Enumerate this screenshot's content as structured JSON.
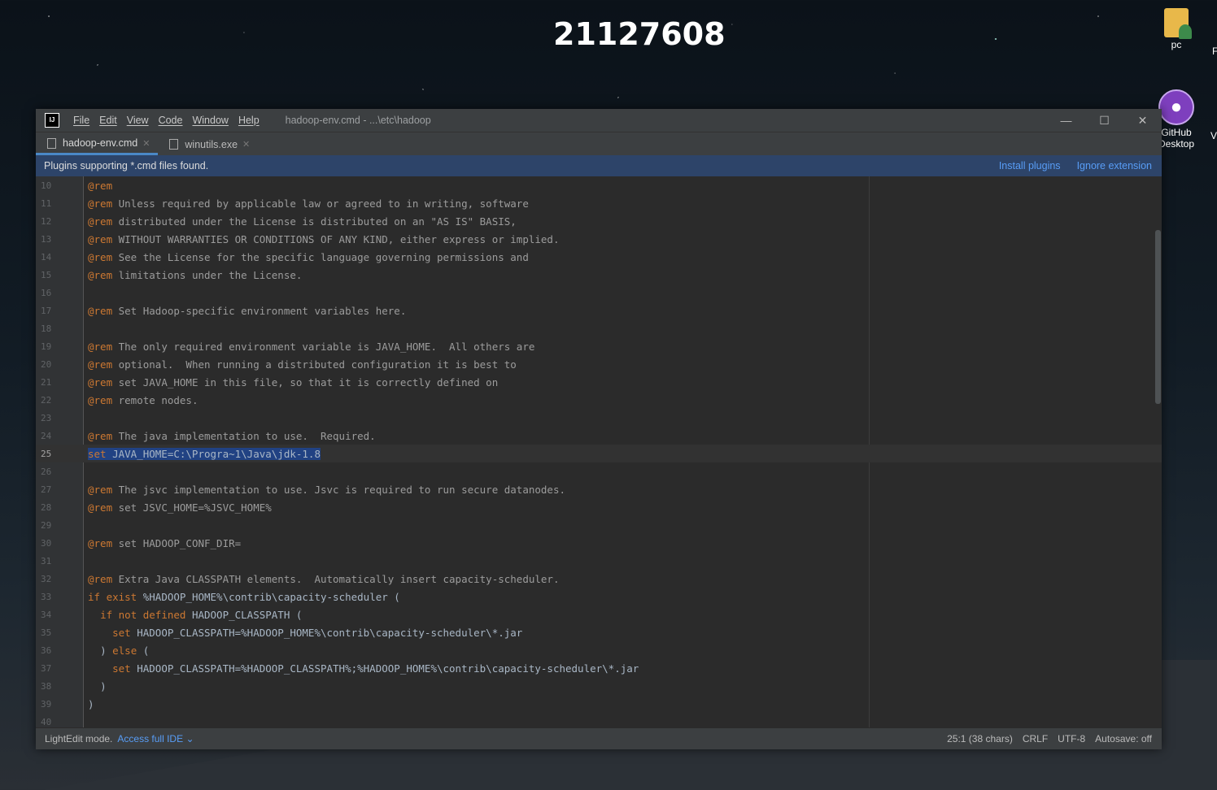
{
  "desktop": {
    "session_number": "21127608",
    "icons": [
      {
        "label": "pc",
        "icon": "user-folder-icon"
      },
      {
        "label": "GitHub Desktop",
        "icon": "github-desktop-icon"
      }
    ],
    "edge_letters": [
      "F",
      "V"
    ]
  },
  "window": {
    "logo": "IJ",
    "menu": [
      "File",
      "Edit",
      "View",
      "Code",
      "Window",
      "Help"
    ],
    "title": "hadoop-env.cmd - ...\\etc\\hadoop",
    "controls": {
      "minimize": "—",
      "maximize": "☐",
      "close": "✕"
    }
  },
  "tabs": [
    {
      "label": "hadoop-env.cmd",
      "active": true
    },
    {
      "label": "winutils.exe",
      "active": false
    }
  ],
  "banner": {
    "message": "Plugins supporting *.cmd files found.",
    "install": "Install plugins",
    "ignore": "Ignore extension"
  },
  "editor": {
    "current_line": 25,
    "lines": [
      {
        "n": "10",
        "kw": "@rem",
        "text": ""
      },
      {
        "n": "11",
        "kw": "@rem",
        "text": " Unless required by applicable law or agreed to in writing, software"
      },
      {
        "n": "12",
        "kw": "@rem",
        "text": " distributed under the License is distributed on an \"AS IS\" BASIS,"
      },
      {
        "n": "13",
        "kw": "@rem",
        "text": " WITHOUT WARRANTIES OR CONDITIONS OF ANY KIND, either express or implied."
      },
      {
        "n": "14",
        "kw": "@rem",
        "text": " See the License for the specific language governing permissions and"
      },
      {
        "n": "15",
        "kw": "@rem",
        "text": " limitations under the License."
      },
      {
        "n": "16",
        "kw": "",
        "text": ""
      },
      {
        "n": "17",
        "kw": "@rem",
        "text": " Set Hadoop-specific environment variables here."
      },
      {
        "n": "18",
        "kw": "",
        "text": ""
      },
      {
        "n": "19",
        "kw": "@rem",
        "text": " The only required environment variable is JAVA_HOME.  All others are"
      },
      {
        "n": "20",
        "kw": "@rem",
        "text": " optional.  When running a distributed configuration it is best to"
      },
      {
        "n": "21",
        "kw": "@rem",
        "text": " set JAVA_HOME in this file, so that it is correctly defined on"
      },
      {
        "n": "22",
        "kw": "@rem",
        "text": " remote nodes."
      },
      {
        "n": "23",
        "kw": "",
        "text": ""
      },
      {
        "n": "24",
        "kw": "@rem",
        "text": " The java implementation to use.  Required."
      },
      {
        "n": "25",
        "kw": "set",
        "text": " JAVA_HOME=C:\\Progra~1\\Java\\jdk-1.8",
        "selected": true
      },
      {
        "n": "26",
        "kw": "",
        "text": ""
      },
      {
        "n": "27",
        "kw": "@rem",
        "text": " The jsvc implementation to use. Jsvc is required to run secure datanodes."
      },
      {
        "n": "28",
        "kw": "@rem",
        "text": " set JSVC_HOME=%JSVC_HOME%"
      },
      {
        "n": "29",
        "kw": "",
        "text": ""
      },
      {
        "n": "30",
        "kw": "@rem",
        "text": " set HADOOP_CONF_DIR="
      },
      {
        "n": "31",
        "kw": "",
        "text": ""
      },
      {
        "n": "32",
        "kw": "@rem",
        "text": " Extra Java CLASSPATH elements.  Automatically insert capacity-scheduler."
      },
      {
        "n": "33",
        "kw": "if exist",
        "text": " %HADOOP_HOME%\\contrib\\capacity-scheduler ("
      },
      {
        "n": "34",
        "indent": "  ",
        "kw": "if not defined",
        "text": " HADOOP_CLASSPATH ("
      },
      {
        "n": "35",
        "indent": "    ",
        "kw": "set",
        "text": " HADOOP_CLASSPATH=%HADOOP_HOME%\\contrib\\capacity-scheduler\\*.jar"
      },
      {
        "n": "36",
        "indent": "  ",
        "kw": "",
        "text": ") ",
        "kw2": "else",
        "text2": " ("
      },
      {
        "n": "37",
        "indent": "    ",
        "kw": "set",
        "text": " HADOOP_CLASSPATH=%HADOOP_CLASSPATH%;%HADOOP_HOME%\\contrib\\capacity-scheduler\\*.jar"
      },
      {
        "n": "38",
        "indent": "  ",
        "kw": "",
        "text": ")"
      },
      {
        "n": "39",
        "kw": "",
        "text": ")"
      },
      {
        "n": "40",
        "kw": "",
        "text": ""
      }
    ]
  },
  "status": {
    "mode": "LightEdit mode.",
    "access": "Access full IDE",
    "position": "25:1 (38 chars)",
    "line_sep": "CRLF",
    "encoding": "UTF-8",
    "autosave": "Autosave: off"
  },
  "colors": {
    "keyword": "#cc7832",
    "comment": "#9c9c9c",
    "selection": "#214283",
    "link": "#589df6",
    "banner": "#2d4469"
  }
}
